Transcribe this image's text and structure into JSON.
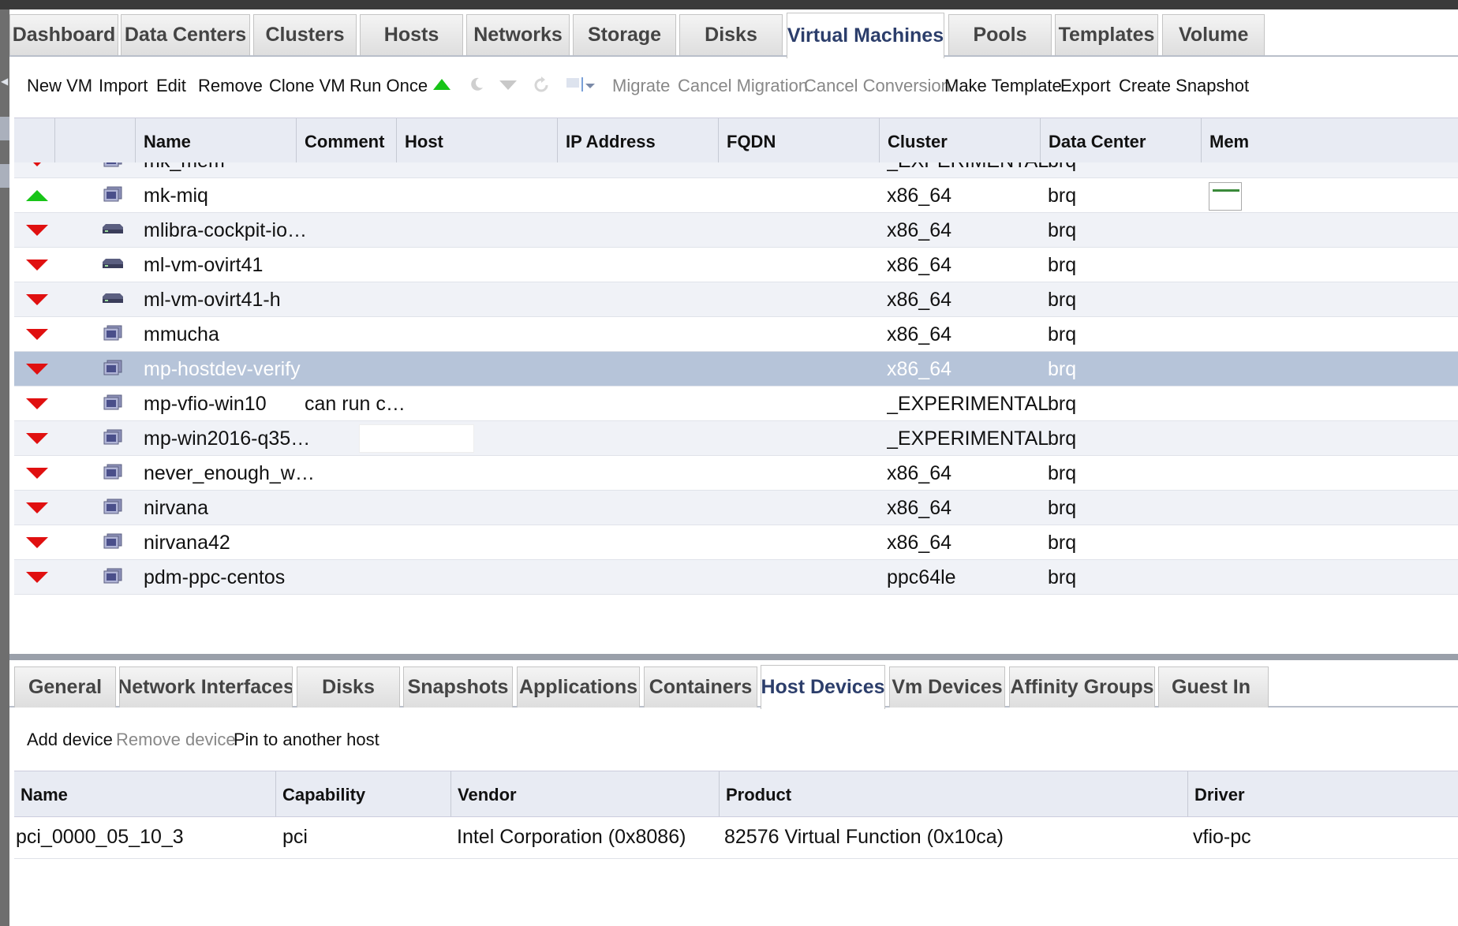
{
  "main_tabs": [
    {
      "label": "Dashboard"
    },
    {
      "label": "Data Centers"
    },
    {
      "label": "Clusters"
    },
    {
      "label": "Hosts"
    },
    {
      "label": "Networks"
    },
    {
      "label": "Storage"
    },
    {
      "label": "Disks"
    },
    {
      "label": "Virtual Machines",
      "active": true
    },
    {
      "label": "Pools"
    },
    {
      "label": "Templates"
    },
    {
      "label": "Volume"
    }
  ],
  "toolbar": {
    "new_vm": "New VM",
    "import": "Import",
    "edit": "Edit",
    "remove": "Remove",
    "clone_vm": "Clone VM",
    "run_once": "Run Once",
    "migrate": "Migrate",
    "cancel_migration": "Cancel Migration",
    "cancel_conversion": "Cancel Conversion",
    "make_template": "Make Template",
    "export": "Export",
    "create_snapshot": "Create Snapshot"
  },
  "vm_grid": {
    "columns": {
      "name": "Name",
      "comment": "Comment",
      "host": "Host",
      "ip": "IP Address",
      "fqdn": "FQDN",
      "cluster": "Cluster",
      "datacenter": "Data Center",
      "memory": "Mem"
    },
    "rows": [
      {
        "status": "down",
        "icon": "desktop-icon",
        "name": "mk_mem",
        "comment": "",
        "cluster": "_EXPERIMENTAL",
        "datacenter": "brq"
      },
      {
        "status": "up",
        "icon": "desktop-icon",
        "name": "mk-miq",
        "comment": "",
        "cluster": "x86_64",
        "datacenter": "brq",
        "memory_gauge": true
      },
      {
        "status": "down",
        "icon": "server-icon",
        "name": "mlibra-cockpit-io…",
        "comment": "",
        "cluster": "x86_64",
        "datacenter": "brq"
      },
      {
        "status": "down",
        "icon": "server-icon",
        "name": "ml-vm-ovirt41",
        "comment": "",
        "cluster": "x86_64",
        "datacenter": "brq"
      },
      {
        "status": "down",
        "icon": "server-icon",
        "name": "ml-vm-ovirt41-h",
        "comment": "",
        "cluster": "x86_64",
        "datacenter": "brq"
      },
      {
        "status": "down",
        "icon": "desktop-icon",
        "name": "mmucha",
        "comment": "",
        "cluster": "x86_64",
        "datacenter": "brq"
      },
      {
        "status": "down",
        "icon": "desktop-icon",
        "name": "mp-hostdev-verify",
        "comment": "",
        "cluster": "x86_64",
        "datacenter": "brq",
        "selected": true
      },
      {
        "status": "down",
        "icon": "desktop-icon",
        "name": "mp-vfio-win10",
        "comment": "can run c…",
        "cluster": "_EXPERIMENTAL",
        "datacenter": "brq"
      },
      {
        "status": "down",
        "icon": "desktop-icon",
        "name": "mp-win2016-q35…",
        "comment": "",
        "comment_box": true,
        "cluster": "_EXPERIMENTAL",
        "datacenter": "brq"
      },
      {
        "status": "down",
        "icon": "desktop-icon",
        "name": "never_enough_w…",
        "comment": "",
        "cluster": "x86_64",
        "datacenter": "brq"
      },
      {
        "status": "down",
        "icon": "desktop-icon",
        "name": "nirvana",
        "comment": "",
        "cluster": "x86_64",
        "datacenter": "brq"
      },
      {
        "status": "down",
        "icon": "desktop-icon",
        "name": "nirvana42",
        "comment": "",
        "cluster": "x86_64",
        "datacenter": "brq"
      },
      {
        "status": "down",
        "icon": "desktop-icon",
        "name": "pdm-ppc-centos",
        "comment": "",
        "cluster": "ppc64le",
        "datacenter": "brq"
      }
    ]
  },
  "sub_tabs": [
    {
      "label": "General"
    },
    {
      "label": "Network Interfaces"
    },
    {
      "label": "Disks"
    },
    {
      "label": "Snapshots"
    },
    {
      "label": "Applications"
    },
    {
      "label": "Containers"
    },
    {
      "label": "Host Devices",
      "active": true
    },
    {
      "label": "Vm Devices"
    },
    {
      "label": "Affinity Groups"
    },
    {
      "label": "Guest In"
    }
  ],
  "sub_toolbar": {
    "add_device": "Add device",
    "remove_device": "Remove device",
    "pin": "Pin to another host"
  },
  "device_grid": {
    "columns": {
      "name": "Name",
      "capability": "Capability",
      "vendor": "Vendor",
      "product": "Product",
      "driver": "Driver"
    },
    "rows": [
      {
        "name": "pci_0000_05_10_3",
        "capability": "pci",
        "vendor": "Intel Corporation (0x8086)",
        "product": "82576 Virtual Function (0x10ca)",
        "driver": "vfio-pc"
      }
    ]
  },
  "colors": {
    "status_up": "#18c418",
    "status_down": "#e01010",
    "selected_row": "#b6c4d9",
    "active_tab_text": "#2c3e6b"
  }
}
